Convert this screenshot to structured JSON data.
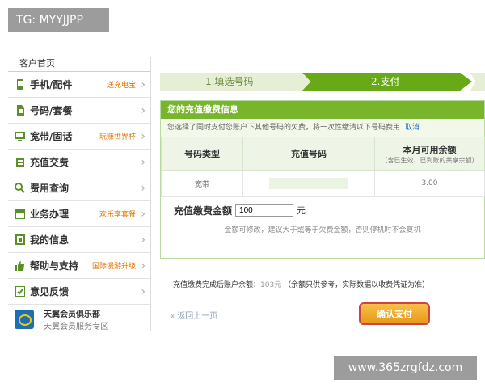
{
  "watermark": {
    "tg": "TG: MYYJJPP",
    "site": "www.365zrgfdz.com"
  },
  "sidebar": {
    "top_label": "客户首页",
    "items": [
      {
        "label": "手机/配件",
        "tag": "送充电宝",
        "icon": "phone-icon"
      },
      {
        "label": "号码/套餐",
        "tag": "",
        "icon": "sim-icon"
      },
      {
        "label": "宽带/固话",
        "tag": "玩赚世界杯",
        "icon": "monitor-icon"
      },
      {
        "label": "充值交费",
        "tag": "",
        "icon": "wallet-icon"
      },
      {
        "label": "费用查询",
        "tag": "",
        "icon": "magnifier-icon"
      },
      {
        "label": "业务办理",
        "tag": "欢乐享套餐",
        "icon": "calendar-icon"
      },
      {
        "label": "我的信息",
        "tag": "",
        "icon": "id-card-icon"
      },
      {
        "label": "帮助与支持",
        "tag": "国际漫游升级",
        "icon": "thumbs-up-icon"
      },
      {
        "label": "意见反馈",
        "tag": "",
        "icon": "feedback-icon"
      }
    ],
    "club": {
      "title": "天翼会员俱乐部",
      "subtitle": "天翼会员服务专区"
    }
  },
  "steps": {
    "step1": "1.填选号码",
    "step2": "2.支付"
  },
  "panel": {
    "title": "您的充值缴费信息",
    "notice": "您选择了同时支付您账户下其他号码的欠费，将一次性缴清以下号码费用",
    "notice_link": "取消",
    "columns": {
      "type": "号码类型",
      "number": "充值号码",
      "balance": "本月可用余额",
      "balance_sub": "（含已生效、已到账的共享余额）"
    },
    "row": {
      "type": "宽带",
      "balance": "3.00"
    },
    "amount_label": "充值缴费金额",
    "amount_value": "100",
    "amount_unit": "元",
    "hint": "金额可修改，建议大于或等于欠费金额，否则停机时不会复机"
  },
  "footer": {
    "balance_label": "充值缴费完成后账户余额：",
    "balance_value": "103元",
    "balance_note": "（余额只供参考，实际数据以收费凭证为准）",
    "back_label": "返回上一页",
    "pay_label": "确认支付"
  },
  "colors": {
    "accent": "#67a917",
    "panel_header": "#77b62c",
    "pay_button": "#e79a17",
    "pay_border": "#cc4444"
  }
}
